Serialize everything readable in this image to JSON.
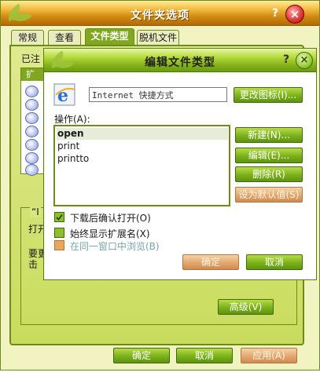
{
  "outer": {
    "title": "文件夹选项",
    "help": "?",
    "close": "×",
    "tabs": [
      "常规",
      "查看",
      "文件类型",
      "脱机文件"
    ],
    "active_tab": 2,
    "registered_label": "已注",
    "list_header": "扩",
    "details_title": "“I",
    "details_text1": "打开",
    "details_text2": "要更",
    "details_text3": "击",
    "advanced_button": "高级(V)",
    "ok_button": "确定",
    "cancel_button": "取消",
    "apply_button": "应用(A)"
  },
  "dialog": {
    "title": "编辑文件类型",
    "help": "?",
    "close": "×",
    "type_name": "Internet 快捷方式",
    "change_icon_button": "更改图标(I)...",
    "actions_label": "操作(A):",
    "actions": [
      "open",
      "print",
      "printto"
    ],
    "selected_action": 0,
    "new_button": "新建(N)...",
    "edit_button": "编辑(E)...",
    "remove_button": "删除(R)",
    "set_default_button": "设为默认值(S)",
    "confirm_open_after_download": "下载后确认打开(O)",
    "always_show_extension": "始终显示扩展名(X)",
    "browse_same_window": "在同一窗口中浏览(B)",
    "ok_button": "确定",
    "cancel_button": "取消"
  },
  "icons": {
    "ie_icon": "internet-explorer-icon",
    "list_file_icon": "file-type-icon"
  },
  "colors": {
    "accent_green": "#7fa820",
    "title_orange": "#d08a10",
    "disabled_orange": "#e0a46c",
    "close_red": "#e23a3a"
  }
}
